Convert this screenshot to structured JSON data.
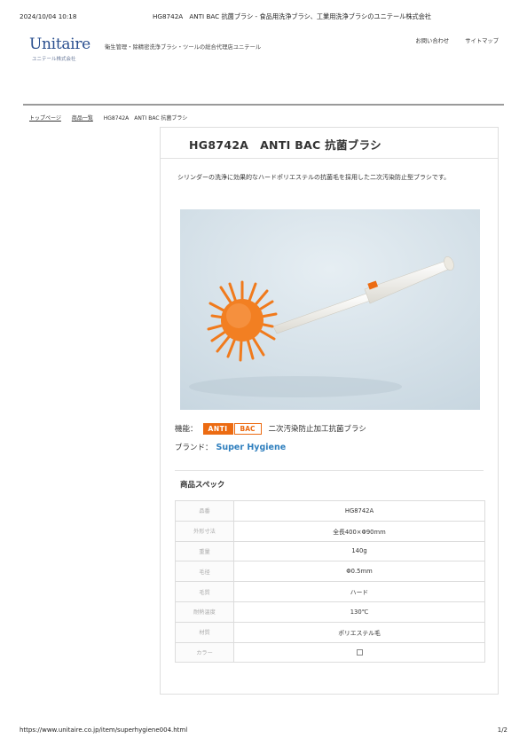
{
  "print_header": {
    "datetime": "2024/10/04 10:18",
    "doc_title": "HG8742A　ANTI BAC 抗菌ブラシ - 食品用洗浄ブラシ、工業用洗浄ブラシのユニテール株式会社"
  },
  "site": {
    "logo_text": "Unitaire",
    "logo_subtext": "ユニテール株式会社",
    "tagline": "衛生管理・除精密洗浄ブラシ・ツールの総合代理店ユニテール",
    "links": [
      "お問い合わせ",
      "サイトマップ"
    ]
  },
  "breadcrumb": [
    "トップページ",
    "商品一覧",
    "HG8742A　ANTI BAC 抗菌ブラシ"
  ],
  "product": {
    "title": "HG8742A　ANTI BAC 抗菌ブラシ",
    "description": "シリンダーの洗浄に効果的なハードポリエステルの抗菌毛を採用した二次汚染防止型ブラシです。",
    "image_alt": "orange-round-bristle-brush-with-white-handle",
    "feature_label": "機能：",
    "badge_anti": "ANTI",
    "badge_bac": "BAC",
    "feature_text": "二次汚染防止加工抗菌ブラシ",
    "brand_label": "ブランド：",
    "brand_name": "Super Hygiene",
    "colors": {
      "accent_orange": "#ec6b12",
      "brand_blue": "#2f7fbe"
    }
  },
  "spec": {
    "heading": "商品スペック",
    "rows": [
      {
        "key": "品番",
        "value": "HG8742A"
      },
      {
        "key": "外形寸法",
        "value": "全長400×Φ90mm"
      },
      {
        "key": "重量",
        "value": "140g"
      },
      {
        "key": "毛径",
        "value": "Φ0.5mm"
      },
      {
        "key": "毛質",
        "value": "ハード"
      },
      {
        "key": "耐熱温度",
        "value": "130℃"
      },
      {
        "key": "材質",
        "value": "ポリエステル毛"
      },
      {
        "key": "カラー",
        "value": ""
      }
    ]
  },
  "print_footer": {
    "url": "https://www.unitaire.co.jp/item/superhygiene004.html",
    "page": "1/2"
  }
}
